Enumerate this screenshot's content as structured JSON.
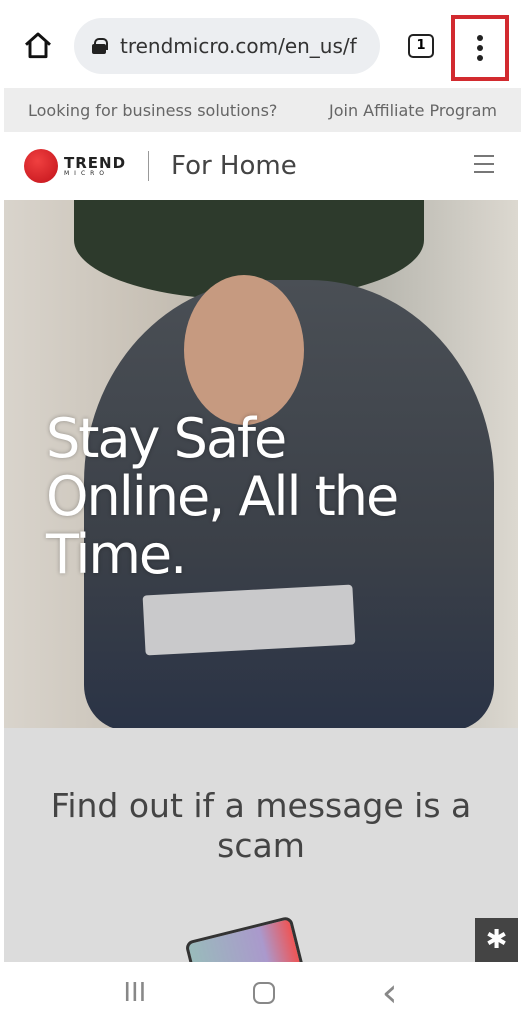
{
  "browser": {
    "url": "trendmicro.com/en_us/f",
    "tab_count": "1",
    "icons": [
      "home-icon",
      "lock-icon",
      "tabs-icon",
      "more-vert-icon"
    ],
    "highlight_color": "#d22a2f"
  },
  "topbar": {
    "business": "Looking for business solutions?",
    "affiliate": "Join Affiliate Program"
  },
  "header": {
    "logo_top": "TREND",
    "logo_bottom": "MICRO",
    "section": "For Home"
  },
  "hero": {
    "headline": "Stay Safe Online, All the Time."
  },
  "scam": {
    "title": "Find out if a message is a scam"
  },
  "navbar": {
    "recents": "III",
    "back": "‹"
  }
}
